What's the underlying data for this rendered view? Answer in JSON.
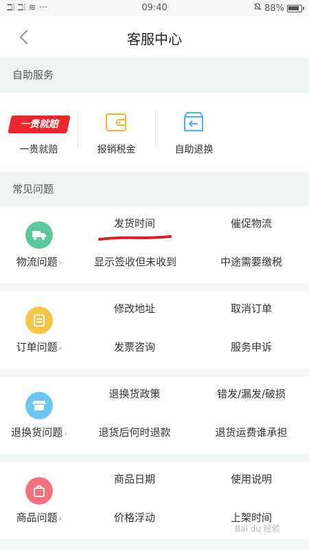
{
  "status_bar": {
    "left": "ℶ⦙ ℶ⦙ ≋ ···",
    "time": "09:40",
    "battery": "88%",
    "bell": "⌁"
  },
  "nav": {
    "title": "客服中心"
  },
  "self_service": {
    "header": "自助服务",
    "items": [
      {
        "label": "一贵就赔",
        "badge": "一贵就赔",
        "icon": "red-badge-icon"
      },
      {
        "label": "报销税金",
        "icon": "wallet-icon"
      },
      {
        "label": "自助退换",
        "icon": "return-box-icon"
      }
    ]
  },
  "faq": {
    "header": "常见问题",
    "categories": [
      {
        "label": "物流问题",
        "color": "#5dc8a0",
        "icon": "truck-icon",
        "questions": [
          "发货时间",
          "催促物流",
          "显示签收但未收到",
          "中途需要缴税"
        ]
      },
      {
        "label": "订单问题",
        "color": "#f6c544",
        "icon": "order-icon",
        "questions": [
          "修改地址",
          "取消订单",
          "发票咨询",
          "服务申诉"
        ]
      },
      {
        "label": "退换货问题",
        "color": "#6cc5f0",
        "icon": "return-shirt-icon",
        "questions": [
          "退换货政策",
          "错发/漏发/破损",
          "退货后何时退款",
          "退货运费谁承担"
        ]
      },
      {
        "label": "商品问题",
        "color": "#f0727f",
        "icon": "bag-icon",
        "questions": [
          "商品日期",
          "使用说明",
          "价格浮动",
          "上架时间"
        ]
      }
    ]
  },
  "watermark": "Bai du 经验"
}
